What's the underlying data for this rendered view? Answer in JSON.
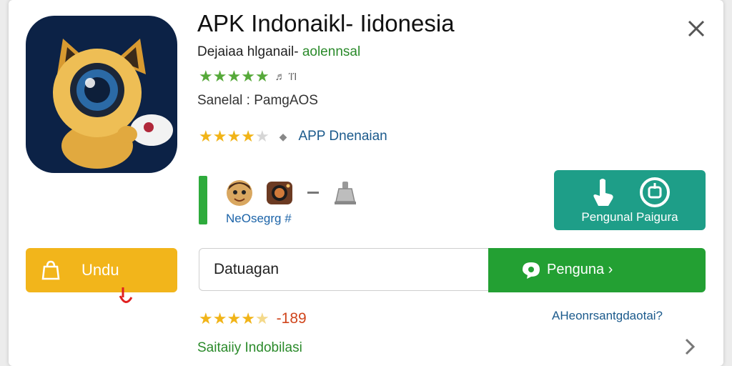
{
  "app": {
    "title": "APK Indonaikl- Iidonesia",
    "subtitle_prefix": "Dejaiaa hlganail- ",
    "subtitle_highlight": "aolennsal",
    "small_rating_meta": "♬ ΊΊ",
    "source": "Sanelal : PamgAOS",
    "app_label": "APP Dnenaian"
  },
  "gallery": {
    "label": "NeOsegrg #"
  },
  "action_card": {
    "label": "Pengunal Paigura"
  },
  "download_button": {
    "label": "Undu"
  },
  "search": {
    "value": "Datuagan"
  },
  "go_button": {
    "label": "Pengunа ›"
  },
  "footer": {
    "rating_count": "-189",
    "link_label": "AHeonrsantgdaotai?",
    "tagline": "Saitaiiy Indobilasi"
  },
  "colors": {
    "accent_green": "#23a033",
    "teal": "#1e9e88",
    "download_yellow": "#f2b51b",
    "icon_bg": "#0c2246",
    "star_gold": "#f1b418"
  },
  "icons": [
    "close-icon",
    "app-mascot-icon",
    "shopping-bag-icon",
    "tag-icon",
    "power-icon",
    "chat-bubble-icon",
    "chevron-right-icon"
  ]
}
